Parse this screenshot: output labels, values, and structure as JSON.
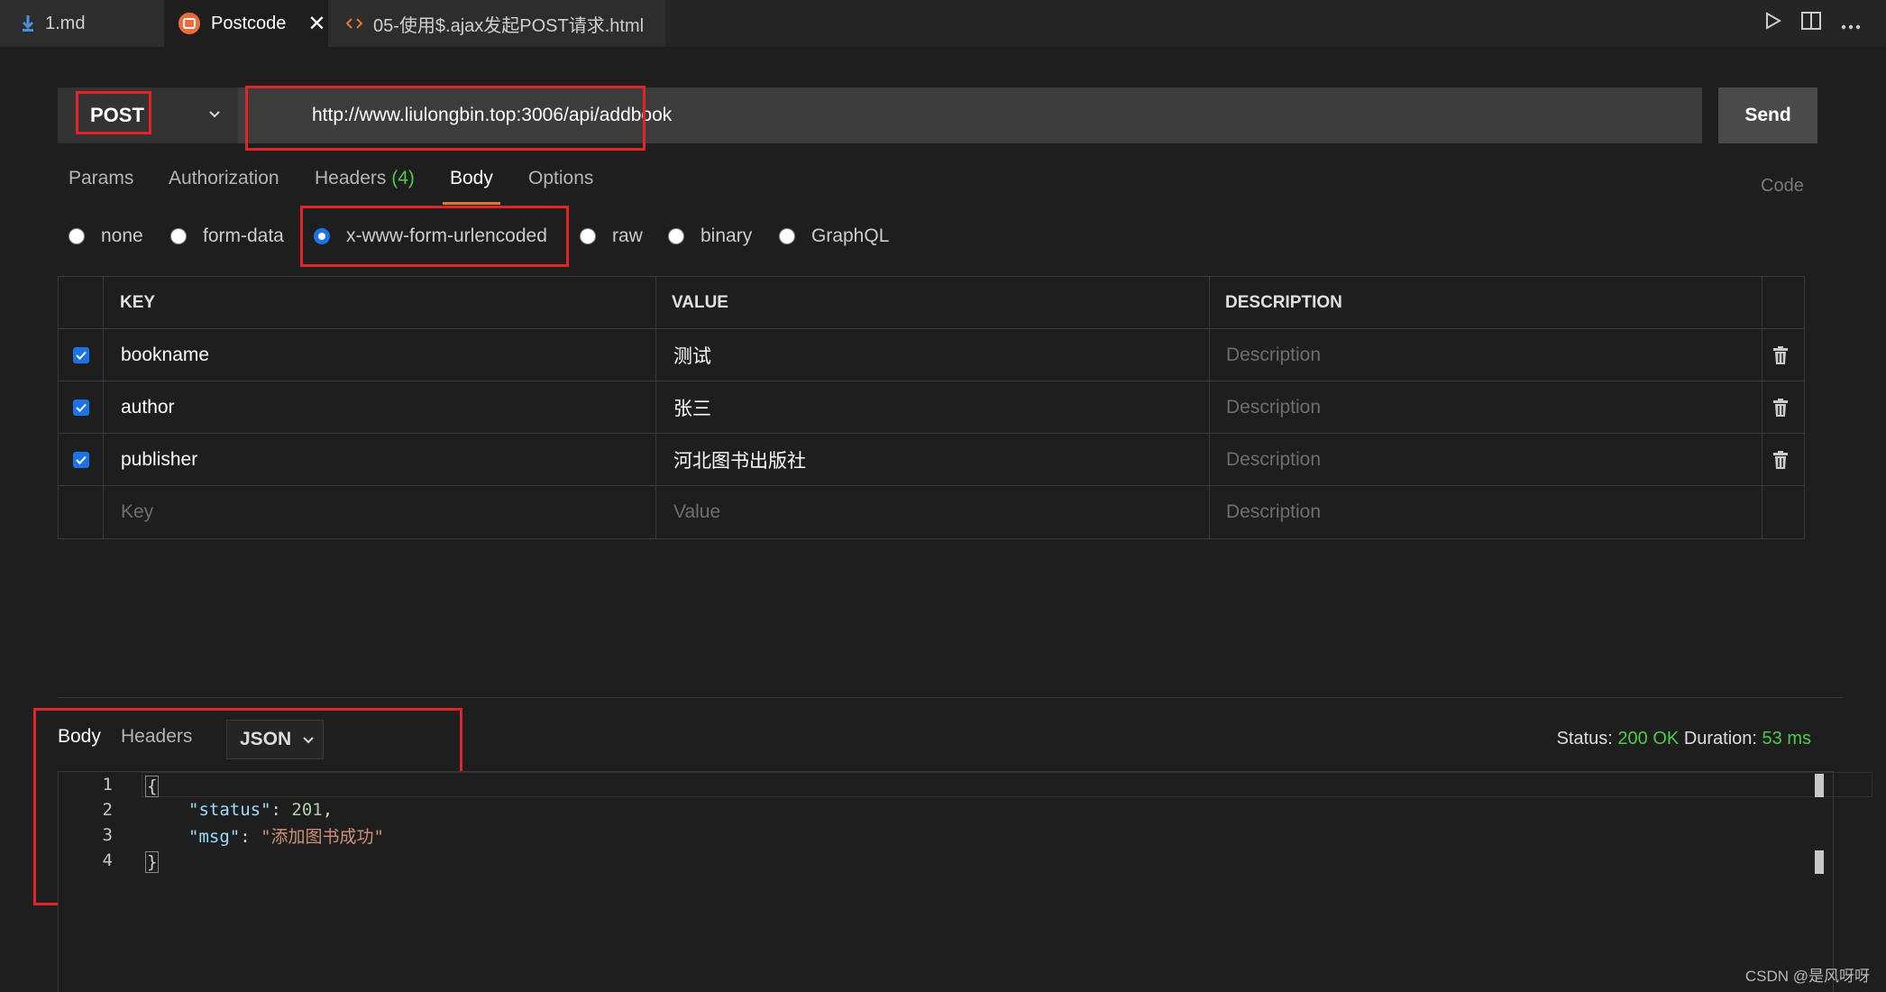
{
  "tabs": [
    {
      "label": "1.md",
      "icon": "download-arrow-icon",
      "active": false
    },
    {
      "label": "Postcode",
      "icon": "postcode-logo-icon",
      "active": true,
      "close": "✕"
    },
    {
      "label": "05-使用$.ajax发起POST请求.html",
      "icon": "code-brackets-icon",
      "active": false
    }
  ],
  "request": {
    "method": "POST",
    "url": "http://www.liulongbin.top:3006/api/addbook",
    "send_label": "Send"
  },
  "request_tabs": [
    {
      "label": "Params"
    },
    {
      "label": "Authorization"
    },
    {
      "label": "Headers",
      "count": "(4)"
    },
    {
      "label": "Body",
      "active": true
    },
    {
      "label": "Options"
    }
  ],
  "code_link": "Code",
  "body_types": [
    {
      "label": "none",
      "selected": false
    },
    {
      "label": "form-data",
      "selected": false
    },
    {
      "label": "x-www-form-urlencoded",
      "selected": true
    },
    {
      "label": "raw",
      "selected": false
    },
    {
      "label": "binary",
      "selected": false
    },
    {
      "label": "GraphQL",
      "selected": false
    }
  ],
  "params_table": {
    "headers": {
      "key": "KEY",
      "value": "VALUE",
      "description": "DESCRIPTION"
    },
    "rows": [
      {
        "checked": true,
        "key": "bookname",
        "value": "测试",
        "description": "Description"
      },
      {
        "checked": true,
        "key": "author",
        "value": "张三",
        "description": "Description"
      },
      {
        "checked": true,
        "key": "publisher",
        "value": "河北图书出版社",
        "description": "Description"
      }
    ],
    "placeholder_row": {
      "key": "Key",
      "value": "Value",
      "description": "Description"
    }
  },
  "response": {
    "tabs": [
      {
        "label": "Body",
        "active": true
      },
      {
        "label": "Headers"
      }
    ],
    "format": "JSON",
    "status_label": "Status:",
    "status_value": "200 OK",
    "duration_label": "Duration:",
    "duration_value": "53 ms",
    "lines": [
      {
        "num": "1",
        "brace": "{"
      },
      {
        "num": "2",
        "key": "\"status\"",
        "colon": ": ",
        "value": "201",
        "trail": ","
      },
      {
        "num": "3",
        "key": "\"msg\"",
        "colon": ": ",
        "value": "\"添加图书成功\""
      },
      {
        "num": "4",
        "brace": "}"
      }
    ]
  },
  "watermark": "CSDN @是风呀呀",
  "colors": {
    "highlight_box": "#e0242a",
    "ok_green": "#4ec94e",
    "checkbox_blue": "#1a73e8",
    "active_tab_underline": "#d97b2b"
  }
}
